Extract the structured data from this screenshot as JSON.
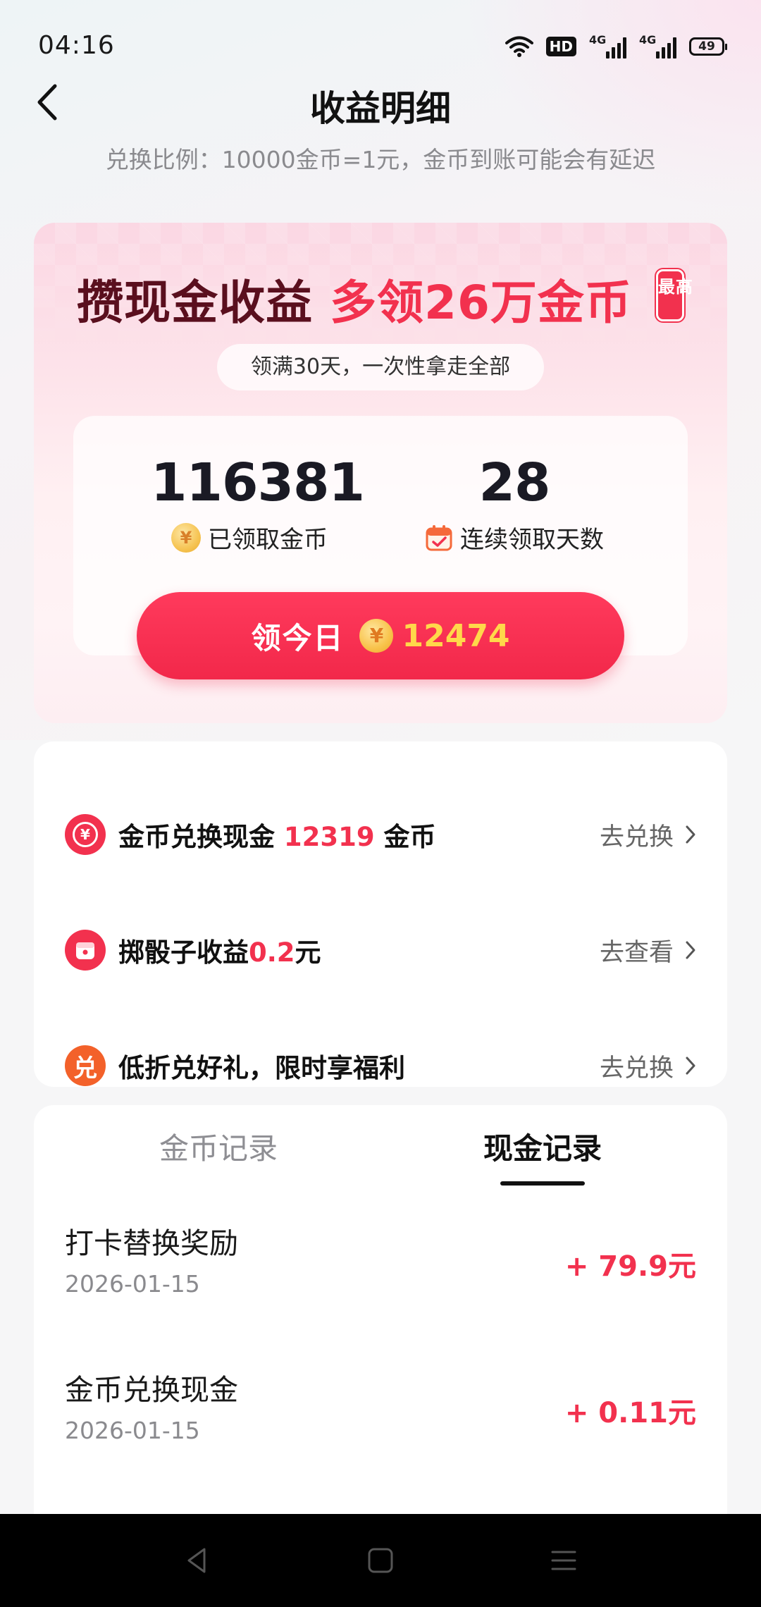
{
  "status_bar": {
    "time": "04:16",
    "hd_label": "HD",
    "signal_1": "4G",
    "signal_2": "4G",
    "battery": "49"
  },
  "header": {
    "title": "收益明细",
    "subtitle": "兑换比例：10000金币=1元，金币到账可能会有延迟"
  },
  "banner": {
    "headline_part1": "攒现金收益",
    "headline_part2": "多领26万金币",
    "badge": "最高",
    "pill_text": "领满30天，一次性拿走全部",
    "coins_value": "116381",
    "coins_label": "已领取金币",
    "days_value": "28",
    "days_label": "连续领取天数",
    "claim_label": "领今日",
    "claim_amount": "12474",
    "coin_symbol": "¥"
  },
  "list": {
    "items": [
      {
        "prefix": "金币兑换现金 ",
        "highlight": "12319",
        "suffix": " 金币",
        "action": "去兑换",
        "icon": "yen-coin-icon"
      },
      {
        "prefix": "掷骰子收益",
        "highlight": "0.2",
        "suffix": "元",
        "action": "去查看",
        "icon": "dice-icon"
      },
      {
        "prefix": "低折兑好礼，限时享福利",
        "highlight": "",
        "suffix": "",
        "action": "去兑换",
        "icon": "exchange-icon",
        "icon_text": "兑"
      }
    ]
  },
  "records": {
    "tabs": [
      {
        "label": "金币记录",
        "active": false
      },
      {
        "label": "现金记录",
        "active": true
      }
    ],
    "entries": [
      {
        "title": "打卡替换奖励",
        "date": "2026-01-15",
        "amount": "+ 79.9元"
      },
      {
        "title": "金币兑换现金",
        "date": "2026-01-15",
        "amount": "+ 0.11元"
      }
    ]
  },
  "colors": {
    "accent": "#f2314e",
    "dark_red": "#5a0f1e",
    "gold": "#ffd84a"
  }
}
